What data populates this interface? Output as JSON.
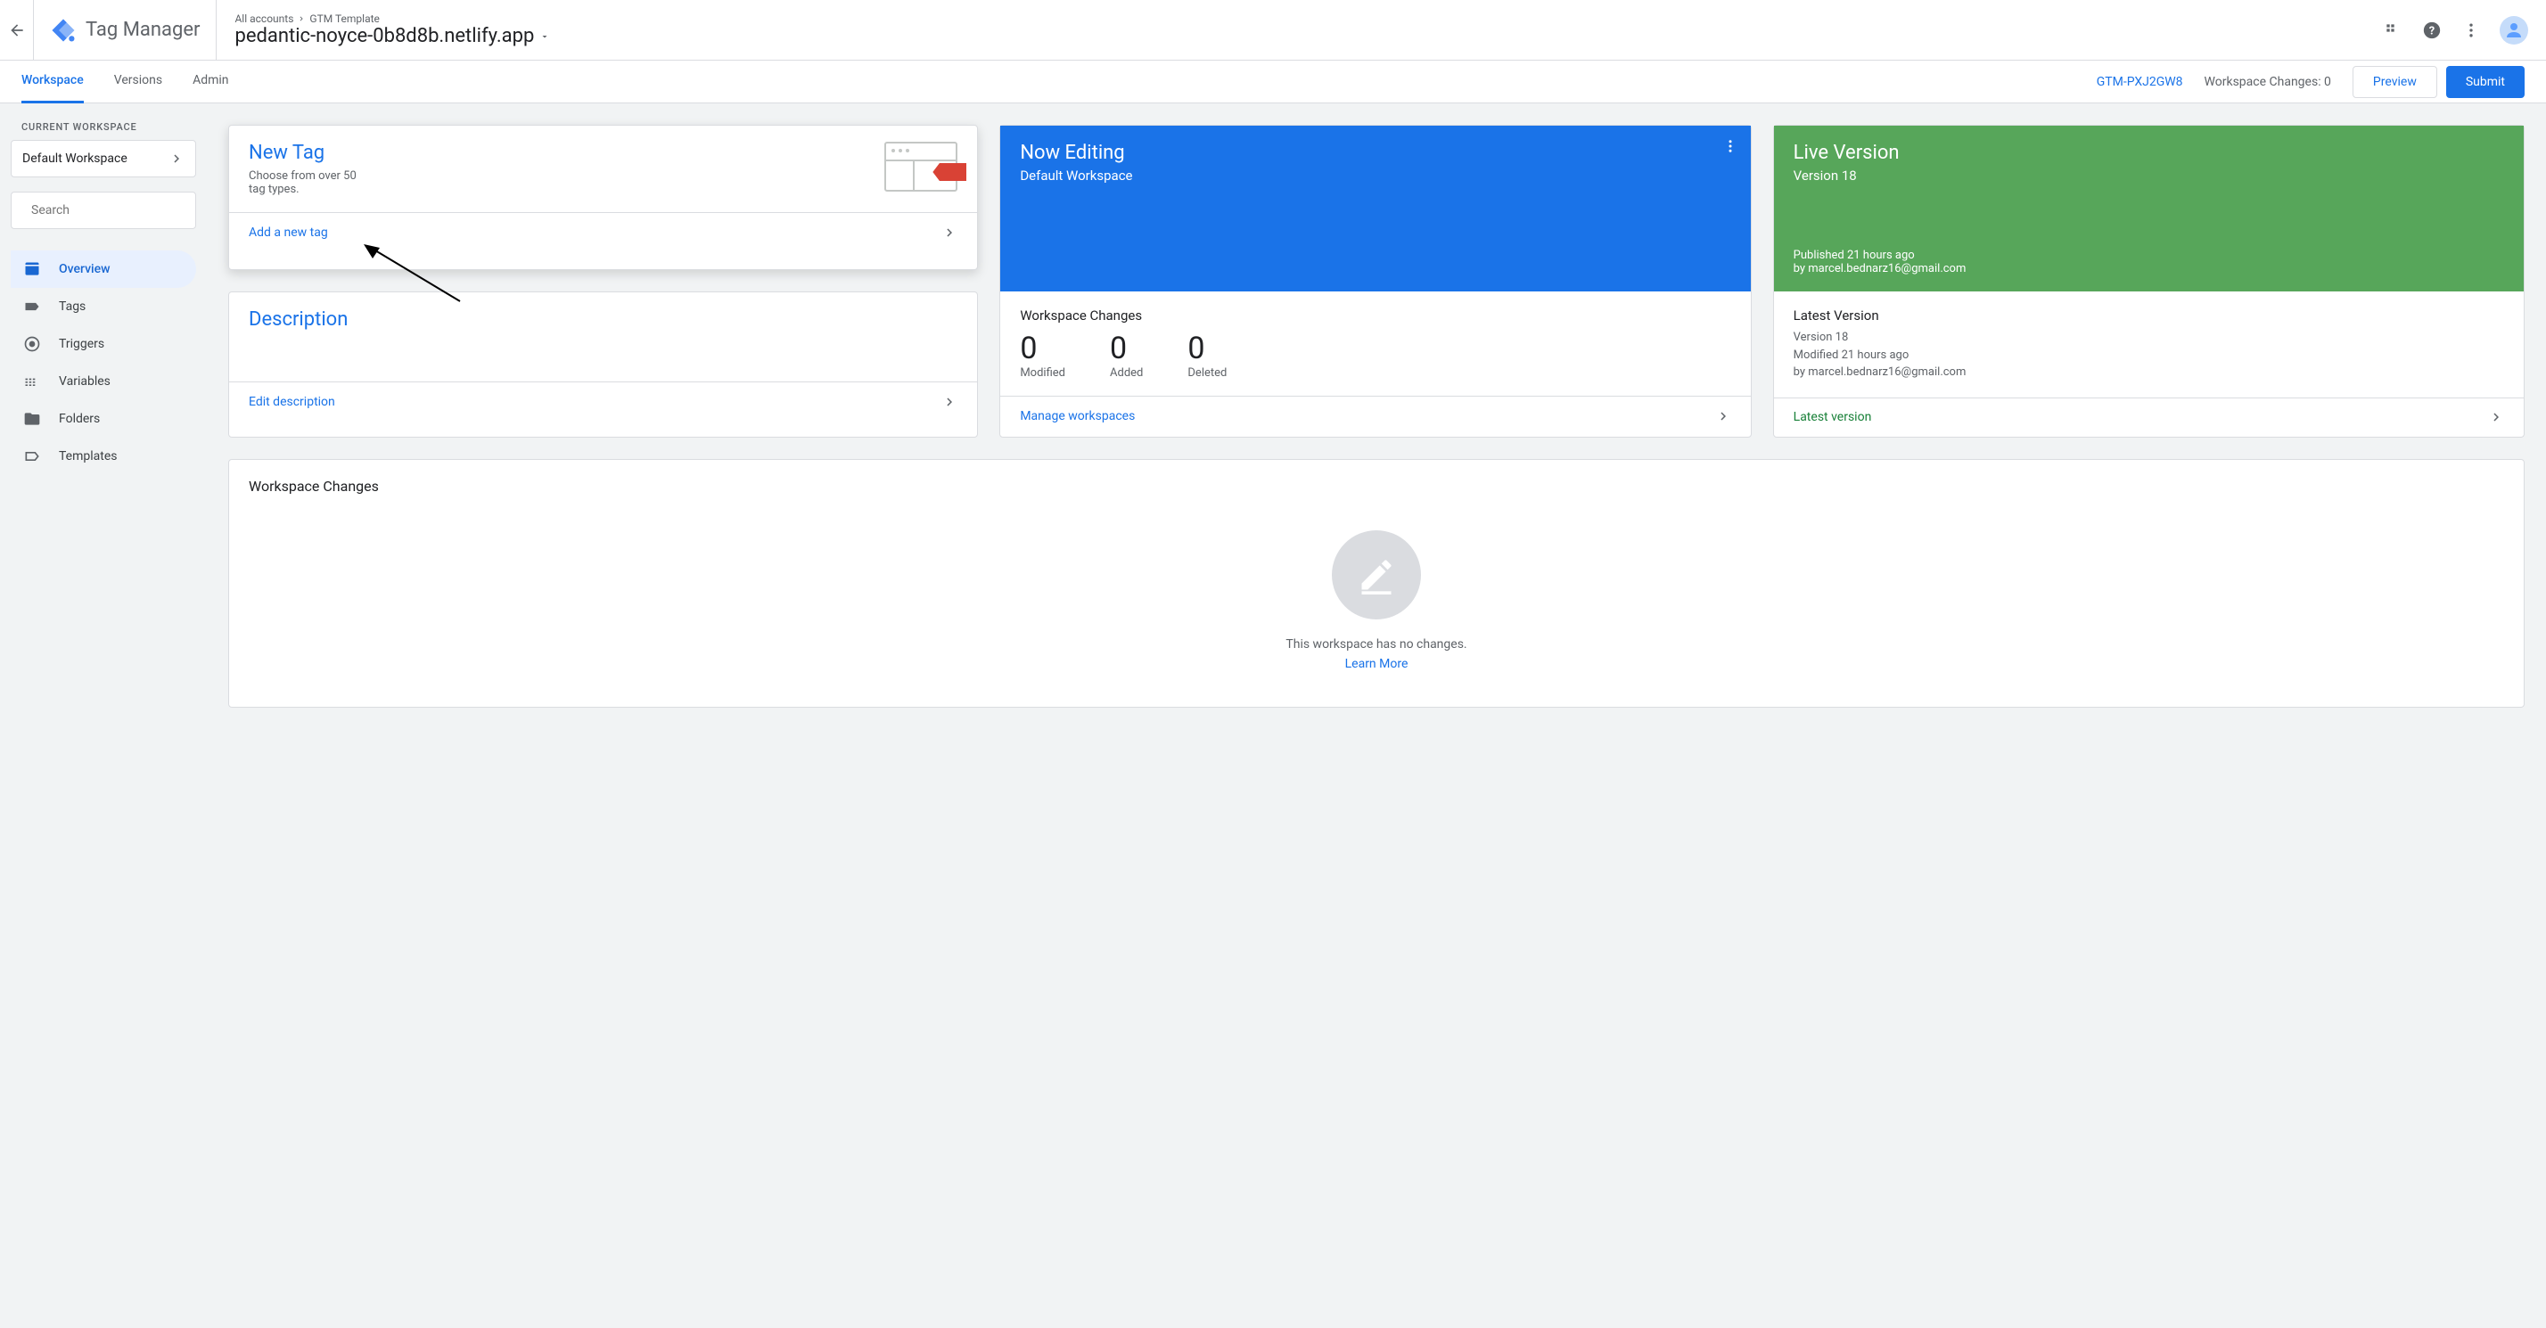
{
  "header": {
    "product_name": "Tag Manager",
    "breadcrumb_root": "All accounts",
    "breadcrumb_account": "GTM Template",
    "container_name": "pedantic-noyce-0b8d8b.netlify.app"
  },
  "subnav": {
    "tabs": [
      "Workspace",
      "Versions",
      "Admin"
    ],
    "container_id": "GTM-PXJ2GW8",
    "workspace_changes_label": "Workspace Changes: 0",
    "preview_label": "Preview",
    "submit_label": "Submit"
  },
  "sidebar": {
    "current_workspace_label": "CURRENT WORKSPACE",
    "workspace_name": "Default Workspace",
    "search_placeholder": "Search",
    "nav": [
      "Overview",
      "Tags",
      "Triggers",
      "Variables",
      "Folders",
      "Templates"
    ]
  },
  "cards": {
    "new_tag": {
      "title": "New Tag",
      "subtitle": "Choose from over 50 tag types.",
      "action": "Add a new tag"
    },
    "description": {
      "title": "Description",
      "action": "Edit description"
    },
    "now_editing": {
      "title": "Now Editing",
      "subtitle": "Default Workspace",
      "body_title": "Workspace Changes",
      "stats": [
        {
          "num": "0",
          "label": "Modified"
        },
        {
          "num": "0",
          "label": "Added"
        },
        {
          "num": "0",
          "label": "Deleted"
        }
      ],
      "action": "Manage workspaces"
    },
    "live": {
      "title": "Live Version",
      "subtitle": "Version 18",
      "published_line": "Published 21 hours ago",
      "by_line": "by marcel.bednarz16@gmail.com",
      "latest_title": "Latest Version",
      "latest_version": "Version 18",
      "latest_modified": "Modified 21 hours ago",
      "latest_by": "by marcel.bednarz16@gmail.com",
      "action": "Latest version"
    }
  },
  "workspace_changes_panel": {
    "title": "Workspace Changes",
    "empty_text": "This workspace has no changes.",
    "learn_more": "Learn More"
  }
}
